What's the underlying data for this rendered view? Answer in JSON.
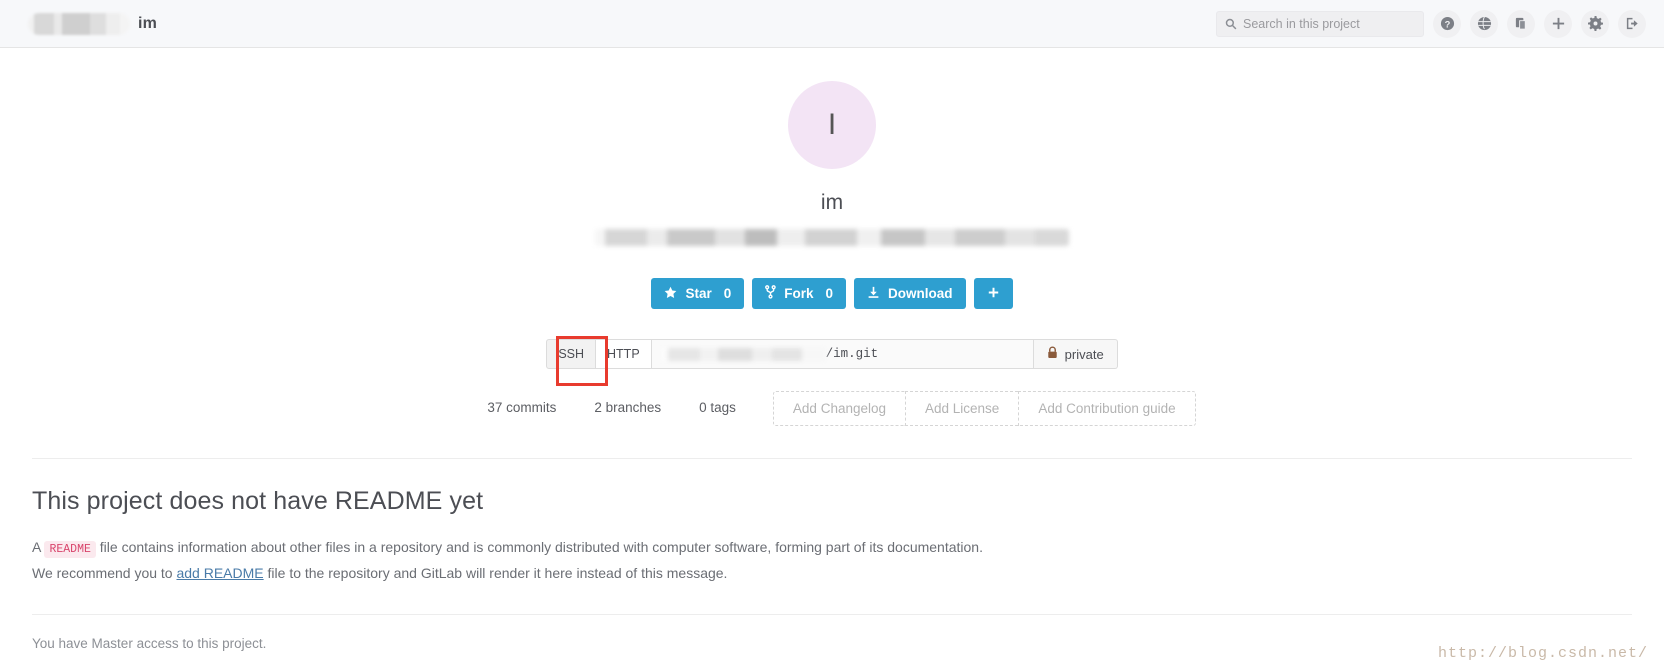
{
  "navbar": {
    "brand_redacted": true,
    "brand_name": "im",
    "search": {
      "placeholder": "Search in this project",
      "value": "",
      "icon": "search-icon"
    },
    "icons": [
      {
        "name": "help-icon",
        "glyph": "?"
      },
      {
        "name": "globe-icon",
        "glyph": "◕"
      },
      {
        "name": "snippets-icon",
        "glyph": "❐"
      },
      {
        "name": "plus-icon",
        "glyph": "+"
      },
      {
        "name": "gear-icon",
        "glyph": "⚙"
      },
      {
        "name": "sign-out-icon",
        "glyph": "⇥"
      }
    ]
  },
  "project": {
    "avatar_letter": "I",
    "avatar_color": "#f3e4f5",
    "title": "im",
    "description_redacted": true
  },
  "actions": {
    "star": {
      "label": "Star",
      "count": "0",
      "icon": "star-icon"
    },
    "fork": {
      "label": "Fork",
      "count": "0",
      "icon": "fork-icon"
    },
    "download": {
      "label": "Download",
      "icon": "download-icon"
    },
    "more": {
      "label": "+",
      "icon": "plus-icon"
    },
    "accent_color": "#2e9fd0"
  },
  "clone": {
    "protocols": [
      {
        "label": "SSH",
        "active": false
      },
      {
        "label": "HTTP",
        "active": true
      }
    ],
    "url_host_redacted": true,
    "url_tail": "/im.git",
    "visibility": {
      "label": "private",
      "icon": "lock-icon"
    },
    "highlight_color": "#e83b2e"
  },
  "stats": {
    "commits": "37 commits",
    "branches": "2 branches",
    "tags": "0 tags",
    "add_buttons": [
      "Add Changelog",
      "Add License",
      "Add Contribution guide"
    ]
  },
  "readme": {
    "heading": "This project does not have README yet",
    "line1_prefix": "A",
    "line1_code": "README",
    "line1_suffix": "file contains information about other files in a repository and is commonly distributed with computer software, forming part of its documentation.",
    "line2_prefix": "We recommend you to",
    "line2_link": "add README",
    "line2_suffix": "file to the repository and GitLab will render it here instead of this message."
  },
  "footer": {
    "access_note": "You have Master access to this project.",
    "watermark": "http://blog.csdn.net/"
  }
}
